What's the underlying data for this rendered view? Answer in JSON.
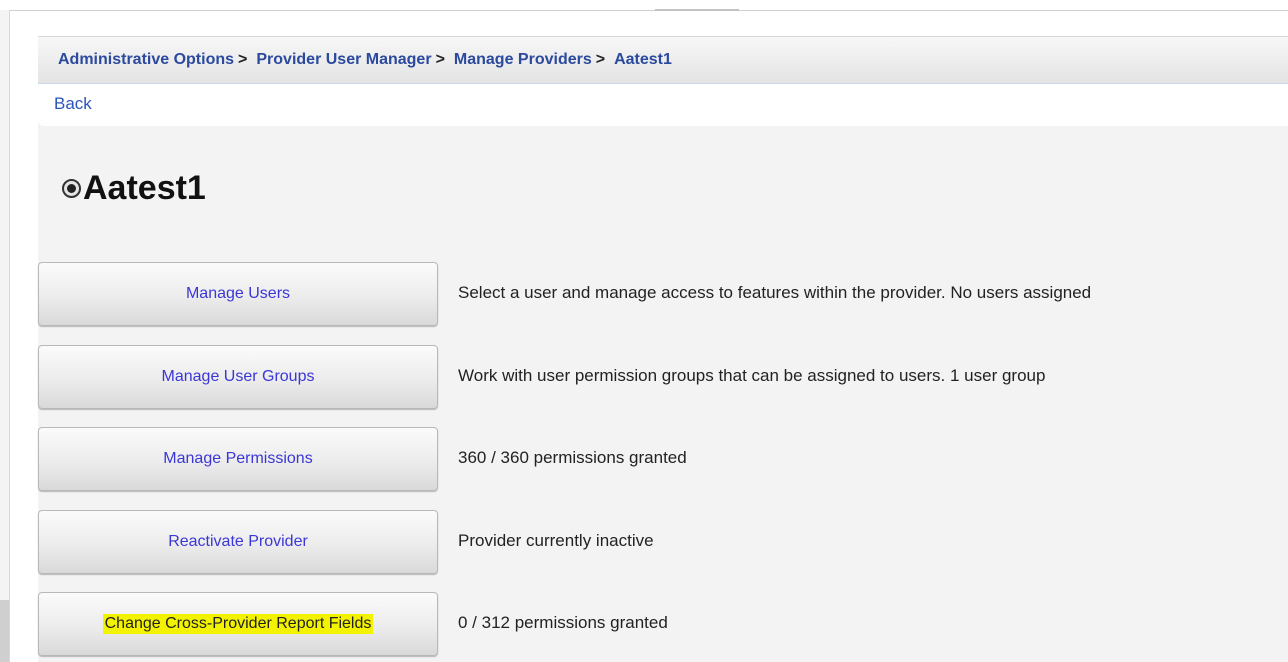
{
  "breadcrumb": {
    "items": [
      "Administrative Options",
      "Provider User Manager",
      "Manage Providers",
      "Aatest1"
    ],
    "separator": ">"
  },
  "back_label": "Back",
  "page_title": "Aatest1",
  "actions": [
    {
      "label": "Manage Users",
      "description": "Select a user and manage access to features within the provider. No users assigned"
    },
    {
      "label": "Manage User Groups",
      "description": "Work with user permission groups that can be assigned to users. 1 user group"
    },
    {
      "label": "Manage Permissions",
      "description": "360 / 360 permissions granted"
    },
    {
      "label": "Reactivate Provider",
      "description": "Provider currently inactive"
    },
    {
      "label": "Change Cross-Provider Report Fields",
      "description": "0 / 312 permissions granted",
      "highlighted": true
    }
  ],
  "colors": {
    "link": "#2b4a9e",
    "button_text": "#3b36d6",
    "highlight": "#f3f300"
  },
  "icons": {
    "title_icon": "radio-selected-icon"
  }
}
